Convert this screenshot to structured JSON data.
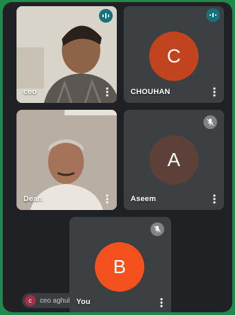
{
  "tiles": {
    "ceo": {
      "name": "ceo"
    },
    "chouhan": {
      "name": "CHOUHAN",
      "initial": "C",
      "color": "#c2441f"
    },
    "dean": {
      "name": "Dean"
    },
    "aseem": {
      "name": "Aseem",
      "initial": "A",
      "color": "#5d4037"
    },
    "you": {
      "name": "You",
      "initial": "B",
      "color": "#f4511e"
    }
  },
  "presenting_chip": {
    "initial": "c",
    "text": "ceo aghul"
  },
  "icons": [
    "speaking-indicator-icon",
    "mic-off-icon",
    "more-options-icon"
  ]
}
